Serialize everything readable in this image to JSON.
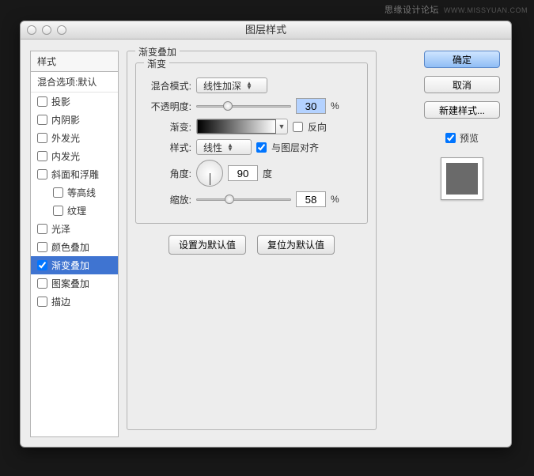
{
  "watermark": {
    "text": "思缘设计论坛",
    "sub": "WWW.MISSYUAN.COM"
  },
  "title": "图层样式",
  "sidebar": {
    "head": "样式",
    "sub": "混合选项:默认",
    "items": [
      {
        "label": "投影",
        "checked": false,
        "sel": false
      },
      {
        "label": "内阴影",
        "checked": false,
        "sel": false
      },
      {
        "label": "外发光",
        "checked": false,
        "sel": false
      },
      {
        "label": "内发光",
        "checked": false,
        "sel": false
      },
      {
        "label": "斜面和浮雕",
        "checked": false,
        "sel": false
      },
      {
        "label": "等高线",
        "checked": false,
        "sel": false,
        "indent": true
      },
      {
        "label": "纹理",
        "checked": false,
        "sel": false,
        "indent": true
      },
      {
        "label": "光泽",
        "checked": false,
        "sel": false
      },
      {
        "label": "颜色叠加",
        "checked": false,
        "sel": false
      },
      {
        "label": "渐变叠加",
        "checked": true,
        "sel": true
      },
      {
        "label": "图案叠加",
        "checked": false,
        "sel": false
      },
      {
        "label": "描边",
        "checked": false,
        "sel": false
      }
    ]
  },
  "panel": {
    "legend": "渐变叠加",
    "inner_legend": "渐变",
    "blend_label": "混合模式:",
    "blend_value": "线性加深",
    "opacity_label": "不透明度:",
    "opacity_value": "30",
    "percent": "%",
    "grad_label": "渐变:",
    "reverse_label": "反向",
    "style_label": "样式:",
    "style_value": "线性",
    "align_label": "与图层对齐",
    "angle_label": "角度:",
    "angle_value": "90",
    "angle_unit": "度",
    "scale_label": "缩放:",
    "scale_value": "58",
    "defaults_btn": "设置为默认值",
    "reset_btn": "复位为默认值"
  },
  "right": {
    "ok": "确定",
    "cancel": "取消",
    "newstyle": "新建样式...",
    "preview": "预览"
  }
}
